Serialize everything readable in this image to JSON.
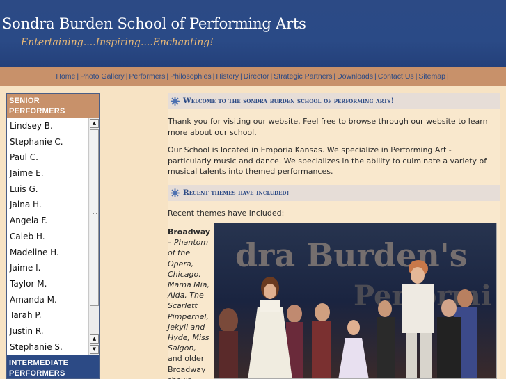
{
  "header": {
    "title": "Sondra Burden School of Performing Arts",
    "tagline": "Entertaining....Inspiring....Enchanting!"
  },
  "nav": {
    "items": [
      "Home",
      "Photo Gallery",
      "Performers",
      "Philosophies",
      "History",
      "Director",
      "Strategic Partners",
      "Downloads",
      "Contact Us",
      "Sitemap"
    ]
  },
  "sidebar": {
    "senior_title_line1": "SENIOR",
    "senior_title_line2": "PERFORMERS",
    "performers": [
      "Lindsey B.",
      "Stephanie C.",
      "Paul C.",
      "Jaime E.",
      "Luis G.",
      "Jalna H.",
      "Angela F.",
      "Caleb H.",
      "Madeline H.",
      "Jaime I.",
      "Taylor M.",
      "Amanda M.",
      "Tarah P.",
      "Justin R.",
      "Stephanie S."
    ],
    "intermediate_title_line1": "INTERMEDIATE",
    "intermediate_title_line2": "PERFORMERS"
  },
  "main": {
    "welcome_heading": "Welcome to the sondra burden school of performing arts!",
    "intro": "Thank you for visiting our website. Feel free to browse through our website to learn more about our school.",
    "location": "Our School is located in Emporia Kansas. We specialize in Performing Art - particularly music and dance. We specializes in the ability to culminate a variety of musical talents into themed performances.",
    "themes_heading": "Recent themes have included:",
    "themes_intro": "Recent themes have included:",
    "broadway_label": "Broadway",
    "broadway_dash": " –",
    "broadway_shows": "Phantom of the Opera, Chicago, Mama Mia, Aida, The Scarlett Pimpernel, Jekyll and Hyde, Miss Saigon,",
    "broadway_tail": " and older Broadway shows such",
    "photo_banner_text": "dra Burden's"
  },
  "colors": {
    "header_blue": "#2c4a85",
    "tagline_gold": "#e8b877",
    "nav_tan": "#c8916a",
    "page_bg": "#f7e3c4"
  }
}
